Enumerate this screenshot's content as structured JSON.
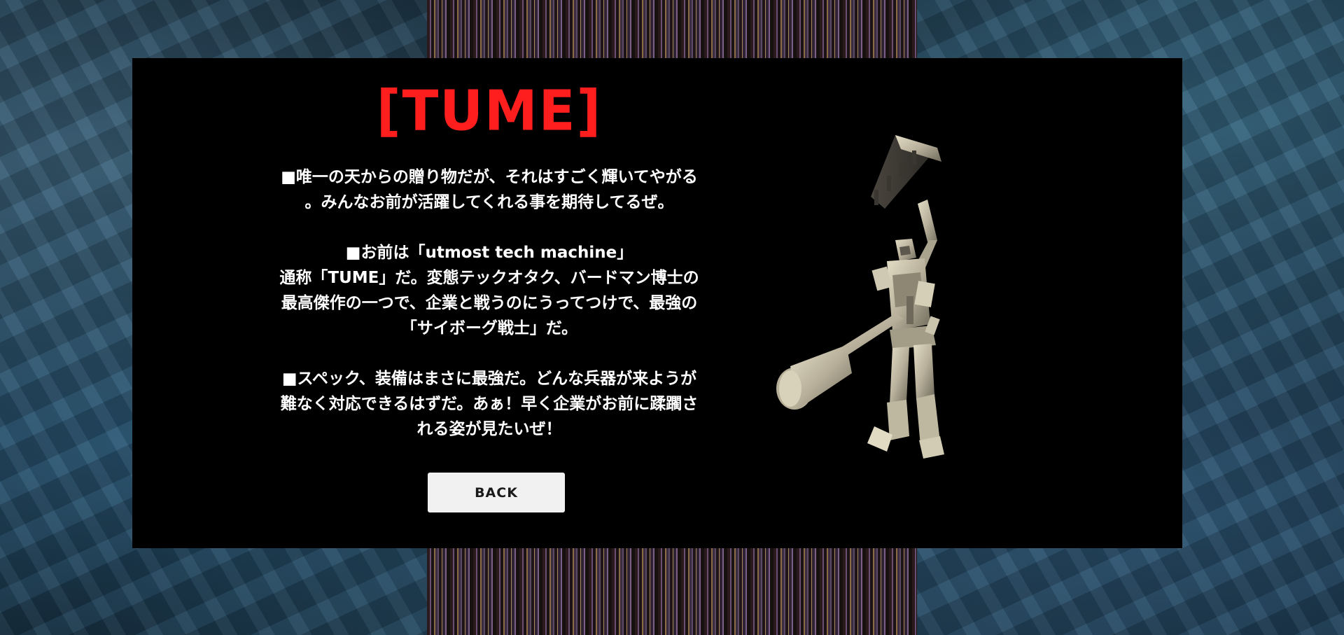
{
  "character": {
    "name": "[TUME]",
    "paragraphs": [
      [
        "■唯一の天からの贈り物だが、それはすごく輝いてやがる",
        "。みんなお前が活躍してくれる事を期待してるぜ。"
      ],
      [
        "■お前は「utmost tech machine」",
        "通称「TUME」だ。変態テックオタク、バードマン博士の",
        "最高傑作の一つで、企業と戦うのにうってつけで、最強の",
        "「サイボーグ戦士」だ。"
      ],
      [
        "■スペック、装備はまさに最強だ。どんな兵器が来ようが",
        "難なく対応できるはずだ。あぁ！早く企業がお前に蹂躙さ",
        "れる姿が見たいぜ！"
      ]
    ]
  },
  "buttons": {
    "back_label": "BACK"
  },
  "colors": {
    "title": "#ff1e1e",
    "panel": "#000000",
    "button_bg": "#f1f1f1",
    "mech": "#c9c2ad"
  },
  "icons": {
    "mech_figure": "mech-robot-icon"
  }
}
